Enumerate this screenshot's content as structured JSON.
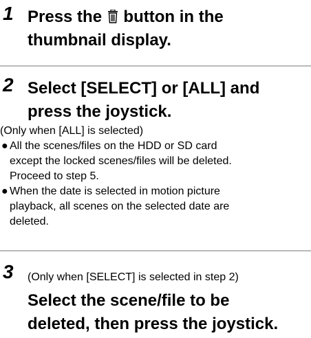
{
  "step1": {
    "number": "1",
    "line1_before": "Press the",
    "icon": "trash-icon",
    "line1_after": "button in the",
    "line2": "thumbnail display."
  },
  "step2": {
    "number": "2",
    "line1": "Select [SELECT] or [ALL] and",
    "line2": "press the joystick.",
    "note": "(Only when [ALL] is selected)",
    "bullets": [
      {
        "lines": [
          "All the scenes/files on the HDD or SD card",
          "except the locked scenes/files will be deleted.",
          "Proceed to step 5."
        ]
      },
      {
        "lines": [
          "When the date is selected in motion picture",
          "playback, all scenes on the selected date are",
          "deleted."
        ]
      }
    ],
    "bullet_glyph": "●"
  },
  "step3": {
    "number": "3",
    "note": "(Only when [SELECT] is selected in step 2)",
    "line2": "Select the scene/file to be",
    "line3": "deleted, then press the joystick."
  }
}
